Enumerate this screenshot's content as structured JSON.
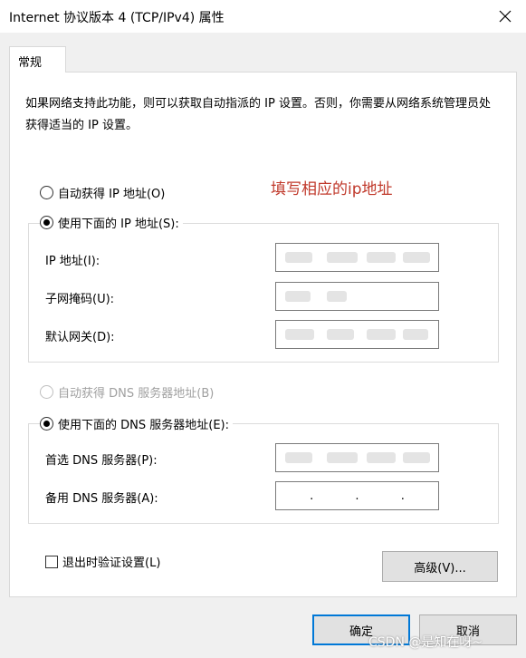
{
  "window": {
    "title": "Internet 协议版本 4 (TCP/IPv4) 属性"
  },
  "tabs": [
    {
      "label": "常规"
    }
  ],
  "description": "如果网络支持此功能，则可以获取自动指派的 IP 设置。否则，你需要从网络系统管理员处获得适当的 IP 设置。",
  "annotation": "填写相应的ip地址",
  "ip_section": {
    "auto_label": "自动获得 IP 地址(O)",
    "manual_label": "使用下面的 IP 地址(S):",
    "selected": "manual",
    "fields": [
      {
        "label": "IP 地址(I):",
        "value": ""
      },
      {
        "label": "子网掩码(U):",
        "value": ""
      },
      {
        "label": "默认网关(D):",
        "value": ""
      }
    ]
  },
  "dns_section": {
    "auto_label": "自动获得 DNS 服务器地址(B)",
    "auto_disabled": true,
    "manual_label": "使用下面的 DNS 服务器地址(E):",
    "selected": "manual",
    "fields": [
      {
        "label": "首选 DNS 服务器(P):",
        "value": ""
      },
      {
        "label": "备用 DNS 服务器(A):",
        "value": "",
        "dots": [
          ".",
          ".",
          "."
        ]
      }
    ]
  },
  "validate_on_exit": {
    "label": "退出时验证设置(L)",
    "checked": false
  },
  "buttons": {
    "advanced": "高级(V)...",
    "ok": "确定",
    "cancel": "取消"
  },
  "watermark": "CSDN @是知在呀~",
  "colors": {
    "annotation": "#c0392b",
    "primary_border": "#0078d7"
  }
}
